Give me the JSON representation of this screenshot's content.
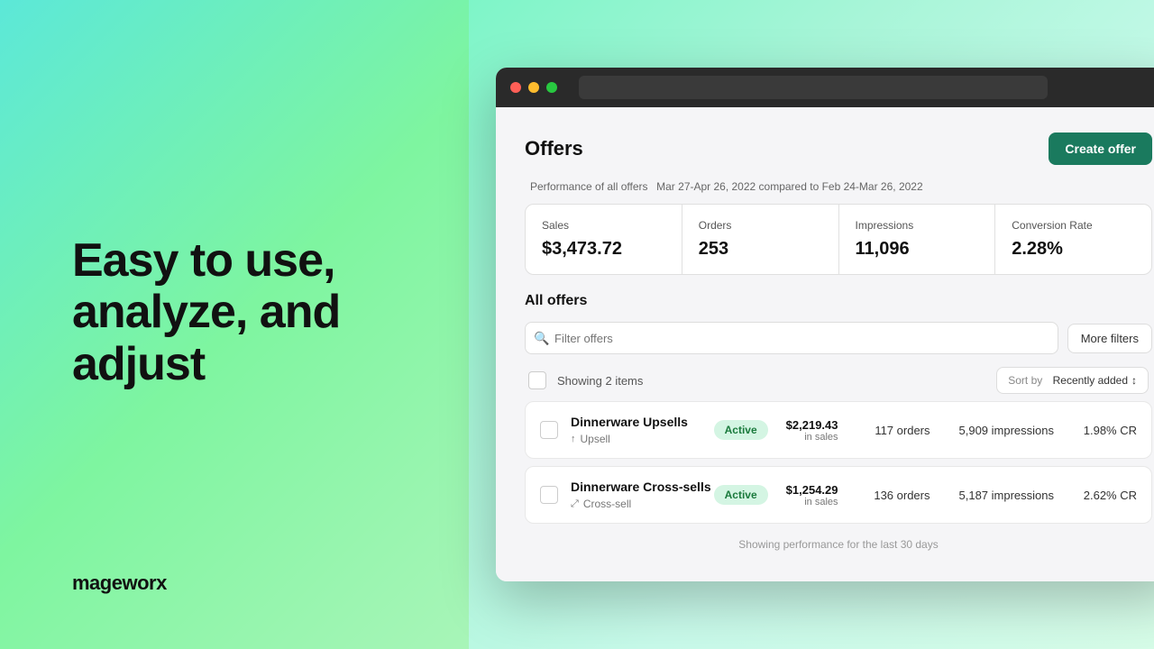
{
  "left": {
    "hero_title": "Easy to use, analyze, and adjust",
    "brand": "mageworx"
  },
  "browser": {
    "url_placeholder": ""
  },
  "app": {
    "page_title": "Offers",
    "create_button": "Create offer",
    "performance": {
      "label": "Performance of all offers",
      "date_range": "Mar 27-Apr 26, 2022 compared to Feb 24-Mar 26, 2022",
      "stats": [
        {
          "label": "Sales",
          "value": "$3,473.72"
        },
        {
          "label": "Orders",
          "value": "253"
        },
        {
          "label": "Impressions",
          "value": "11,096"
        },
        {
          "label": "Conversion Rate",
          "value": "2.28%"
        }
      ]
    },
    "all_offers": {
      "section_title": "All offers",
      "search_placeholder": "Filter offers",
      "more_filters_label": "More filters",
      "showing_text": "Showing 2 items",
      "sort_prefix": "Sort by",
      "sort_value": "Recently added",
      "offers": [
        {
          "name": "Dinnerware Upsells",
          "type": "Upsell",
          "type_icon": "↑",
          "status": "Active",
          "sales": "$2,219.43 in sales",
          "orders": "117 orders",
          "impressions": "5,909 impressions",
          "cr": "1.98% CR"
        },
        {
          "name": "Dinnerware Cross-sells",
          "type": "Cross-sell",
          "type_icon": "⤢",
          "status": "Active",
          "sales": "$1,254.29 in sales",
          "orders": "136 orders",
          "impressions": "5,187 impressions",
          "cr": "2.62% CR"
        }
      ],
      "footer_note": "Showing performance for the last 30 days"
    }
  }
}
